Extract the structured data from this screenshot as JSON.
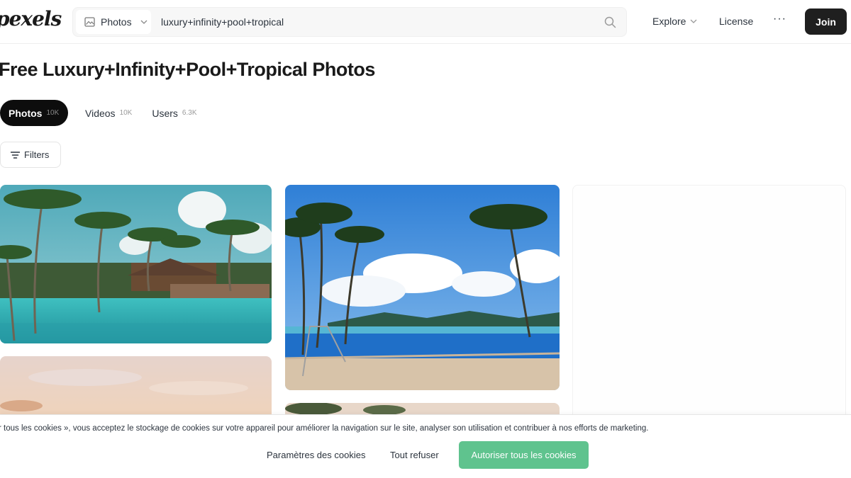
{
  "header": {
    "logo": "pexels",
    "search": {
      "type_label": "Photos",
      "value": "luxury+infinity+pool+tropical"
    },
    "nav": {
      "explore": "Explore",
      "license": "License",
      "more": "···",
      "join": "Join"
    }
  },
  "main": {
    "title": "Free Luxury+Infinity+Pool+Tropical Photos",
    "tabs": [
      {
        "label": "Photos",
        "count": "10K",
        "active": true
      },
      {
        "label": "Videos",
        "count": "10K",
        "active": false
      },
      {
        "label": "Users",
        "count": "6.3K",
        "active": false
      }
    ],
    "filters_label": "Filters"
  },
  "photos": [
    {
      "description_icon": "photo-tropical-infinity-pool-palms"
    },
    {
      "description_icon": "photo-beach-pool-palms-blue-sky"
    },
    {
      "description_icon": "photo-sunset-sky"
    },
    {
      "description_icon": "photo-palms-partial"
    }
  ],
  "cookie_banner": {
    "text": "r tous les cookies », vous acceptez le stockage de cookies sur votre appareil pour améliorer la navigation sur le site, analyser son utilisation et contribuer à nos efforts de marketing.",
    "settings_label": "Paramètres des cookies",
    "refuse_label": "Tout refuser",
    "accept_label": "Autoriser tous les cookies"
  },
  "colors": {
    "join_bg": "#1f1f1f",
    "accept_bg": "#5fc38e",
    "active_tab_bg": "#0d0d0d"
  }
}
